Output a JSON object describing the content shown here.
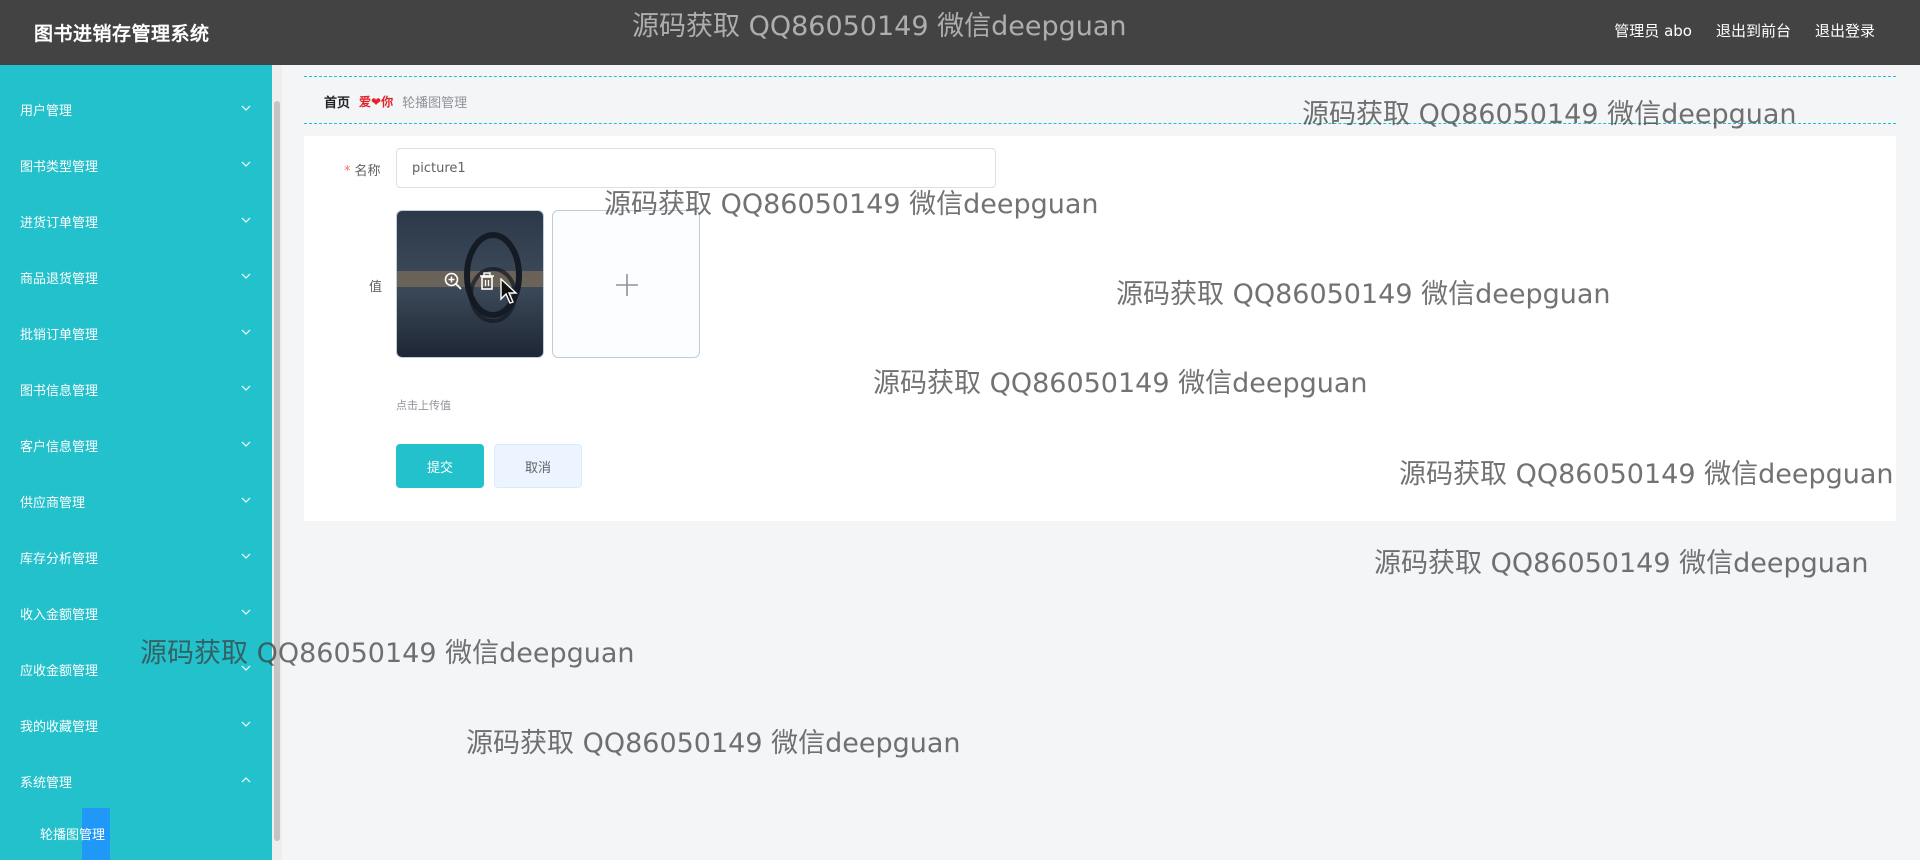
{
  "header": {
    "brand": "图书进销存管理系统",
    "user": "管理员 abo",
    "to_front": "退出到前台",
    "logout": "退出登录"
  },
  "sidebar": {
    "items": [
      {
        "label": "用户管理"
      },
      {
        "label": "图书类型管理"
      },
      {
        "label": "进货订单管理"
      },
      {
        "label": "商品退货管理"
      },
      {
        "label": "批销订单管理"
      },
      {
        "label": "图书信息管理"
      },
      {
        "label": "客户信息管理"
      },
      {
        "label": "供应商管理"
      },
      {
        "label": "库存分析管理"
      },
      {
        "label": "收入金额管理"
      },
      {
        "label": "应收金额管理"
      },
      {
        "label": "我的收藏管理"
      },
      {
        "label": "系统管理"
      }
    ],
    "submenu": {
      "label": "轮播图管理"
    }
  },
  "breadcrumb": {
    "home": "首页",
    "separator": "爱❤你",
    "current": "轮播图管理"
  },
  "form": {
    "name_label": "名称",
    "required_mark": "*",
    "name_value": "picture1",
    "value_label": "值",
    "upload_tip": "点击上传值",
    "submit": "提交",
    "cancel": "取消"
  },
  "watermark": "源码获取 QQ86050149 微信deepguan",
  "colors": {
    "header_bg": "#434343",
    "sidebar_bg": "#23c1cc",
    "accent": "#23c1cc",
    "page_bg": "#f4f5f7"
  }
}
